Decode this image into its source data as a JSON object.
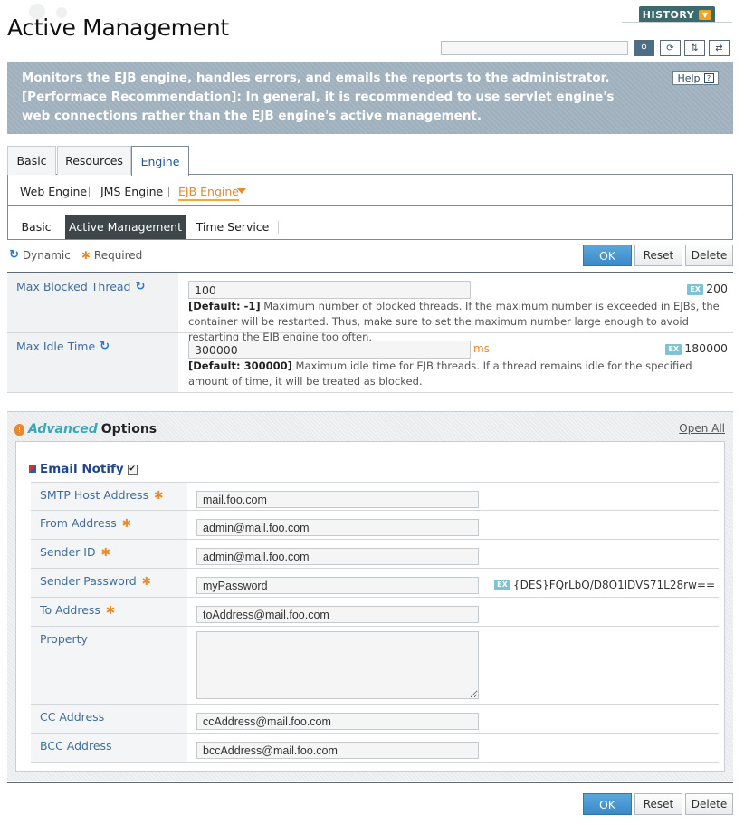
{
  "header": {
    "title": "Active Management",
    "history_label": "HISTORY",
    "search_value": ""
  },
  "description": {
    "text": "Monitors the EJB engine, handles errors, and emails the reports to the administrator. [Performace Recommendation]: In general, it is recommended to use servlet engine's web connections rather than the EJB engine's active management.",
    "help_label": "Help"
  },
  "tabs": [
    "Basic",
    "Resources",
    "Engine"
  ],
  "subnav": [
    "Web Engine",
    "JMS Engine",
    "EJB Engine"
  ],
  "subtabs": [
    "Basic",
    "Active Management",
    "Time Service"
  ],
  "legend": {
    "dynamic": "Dynamic",
    "required": "Required"
  },
  "buttons": {
    "ok": "OK",
    "reset": "Reset",
    "delete": "Delete"
  },
  "fields": {
    "max_blocked_thread": {
      "label": "Max Blocked Thread",
      "value": "100",
      "example": "200",
      "default": "[Default: -1]",
      "desc": "Maximum number of blocked threads. If the maximum number is exceeded in EJBs, the container will be restarted. Thus, make sure to set the maximum number large enough to avoid restarting the EJB engine too often."
    },
    "max_idle_time": {
      "label": "Max Idle Time",
      "value": "300000",
      "unit": "ms",
      "example": "180000",
      "default": "[Default: 300000]",
      "desc": "Maximum idle time for EJB threads. If a thread remains idle for the specified amount of time, it will be treated as blocked."
    }
  },
  "advanced": {
    "title_a": "Advanced",
    "title_b": "Options",
    "open_all": "Open All",
    "email_notify": "Email Notify",
    "ex_label": "EX",
    "rows": {
      "smtp": {
        "label": "SMTP Host Address",
        "value": "mail.foo.com"
      },
      "from": {
        "label": "From Address",
        "value": "admin@mail.foo.com"
      },
      "sender_id": {
        "label": "Sender ID",
        "value": "admin@mail.foo.com"
      },
      "sender_password": {
        "label": "Sender Password",
        "value": "myPassword",
        "encrypted": "{DES}FQrLbQ/D8O1lDVS71L28rw=="
      },
      "to": {
        "label": "To Address",
        "value": "toAddress@mail.foo.com"
      },
      "property": {
        "label": "Property",
        "value": ""
      },
      "cc": {
        "label": "CC Address",
        "value": "ccAddress@mail.foo.com"
      },
      "bcc": {
        "label": "BCC Address",
        "value": "bccAddress@mail.foo.com"
      }
    }
  }
}
